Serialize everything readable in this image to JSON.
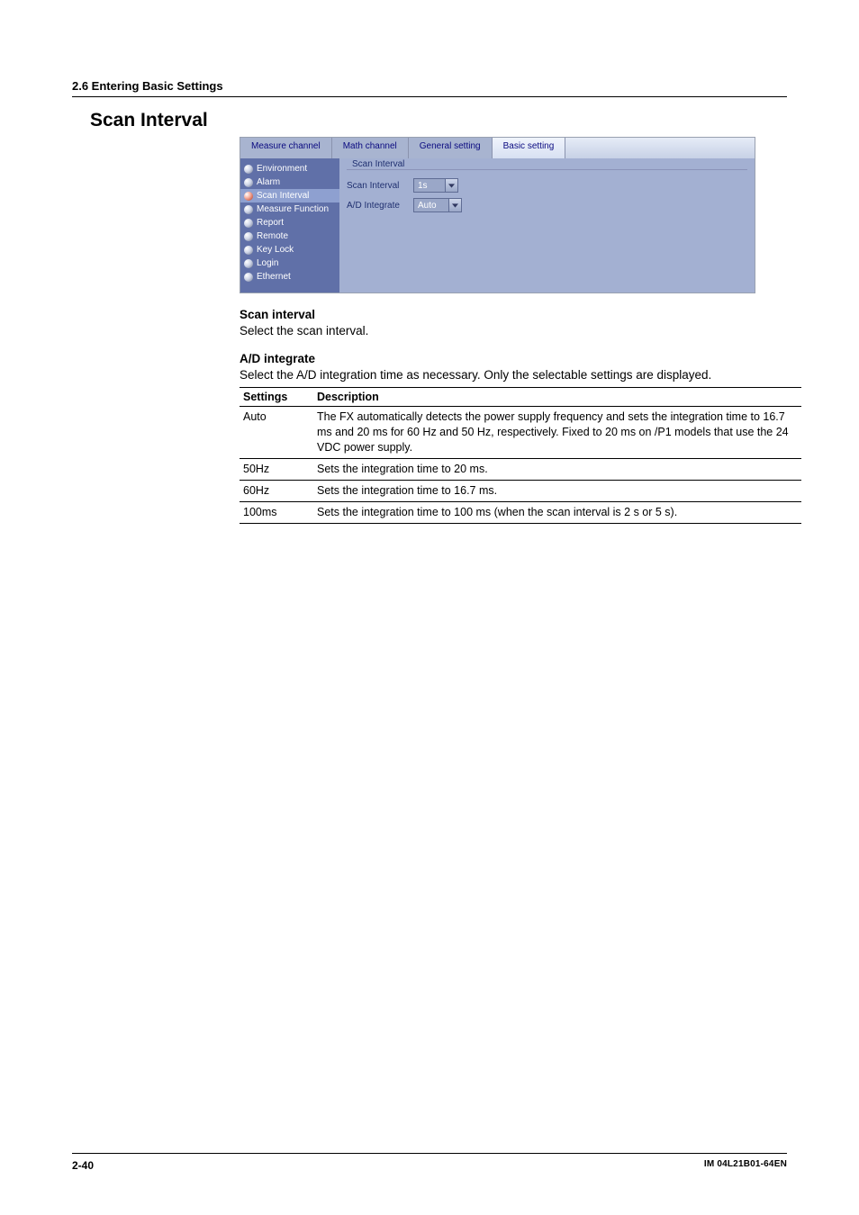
{
  "header": {
    "section": "2.6  Entering Basic Settings",
    "title": "Scan Interval"
  },
  "screenshot": {
    "tabs": [
      "Measure channel",
      "Math channel",
      "General setting",
      "Basic setting"
    ],
    "active_tab_index": 3,
    "sidebar": [
      {
        "label": "Environment",
        "selected": false
      },
      {
        "label": "Alarm",
        "selected": false
      },
      {
        "label": "Scan Interval",
        "selected": true
      },
      {
        "label": "Measure Function",
        "selected": false
      },
      {
        "label": "Report",
        "selected": false
      },
      {
        "label": "Remote",
        "selected": false
      },
      {
        "label": "Key Lock",
        "selected": false
      },
      {
        "label": "Login",
        "selected": false
      },
      {
        "label": "Ethernet",
        "selected": false
      }
    ],
    "panel": {
      "legend": "Scan Interval",
      "rows": [
        {
          "label": "Scan Interval",
          "value": "1s"
        },
        {
          "label": "A/D Integrate",
          "value": "Auto"
        }
      ]
    }
  },
  "sections": {
    "scan_interval": {
      "heading": "Scan interval",
      "text": "Select the scan interval."
    },
    "ad_integrate": {
      "heading": "A/D integrate",
      "text": "Select the A/D integration time as necessary.  Only the selectable settings are displayed."
    }
  },
  "table": {
    "head": [
      "Settings",
      "Description"
    ],
    "rows": [
      {
        "s": "Auto",
        "d": "The FX automatically detects the power supply frequency and sets the integration time to 16.7 ms and 20 ms for 60 Hz and 50 Hz, respectively. Fixed to 20 ms on /P1 models that use the 24 VDC power supply."
      },
      {
        "s": "50Hz",
        "d": "Sets the integration time to 20 ms."
      },
      {
        "s": "60Hz",
        "d": "Sets the integration time to 16.7 ms."
      },
      {
        "s": "100ms",
        "d": "Sets the integration time to 100 ms (when the scan interval is 2 s or 5 s)."
      }
    ]
  },
  "footer": {
    "page": "2-40",
    "doc": "IM 04L21B01-64EN"
  }
}
